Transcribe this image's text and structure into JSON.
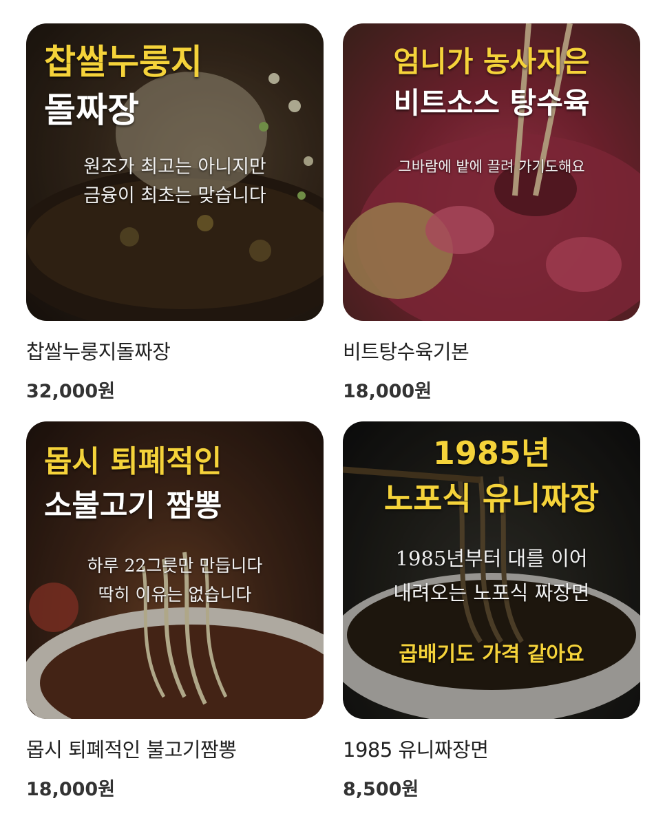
{
  "colors": {
    "accent_yellow": "#f5d33a",
    "text": "#222222",
    "background": "#ffffff"
  },
  "items": [
    {
      "banner_line1": "찹쌀누룽지",
      "banner_line2": "돌짜장",
      "caption_line1": "원조가 최고는 아니지만",
      "caption_line2": "금융이 최초는 맞습니다",
      "name": "찹쌀누룽지돌짜장",
      "price": "32,000원"
    },
    {
      "banner_line1": "엄니가 농사지은",
      "banner_line2": "비트소스 탕수육",
      "caption_line1": "그바람에 밭에 끌려 가기도해요",
      "name": "비트탕수육기본",
      "price": "18,000원"
    },
    {
      "banner_line1": "몹시 퇴폐적인",
      "banner_line2": "소불고기 짬뽕",
      "caption_line1": "하루 22그릇만 만듭니다",
      "caption_line2": "딱히 이유는 없습니다",
      "name": "몹시 퇴폐적인 불고기짬뽕",
      "price": "18,000원"
    },
    {
      "banner_line1": "1985년",
      "banner_line2": "노포식 유니짜장",
      "caption_line1": "1985년부터 대를 이어",
      "caption_line2": "내려오는 노포식 짜장면",
      "banner_footer": "곱배기도 가격 같아요",
      "name": "1985 유니짜장면",
      "price": "8,500원"
    }
  ]
}
